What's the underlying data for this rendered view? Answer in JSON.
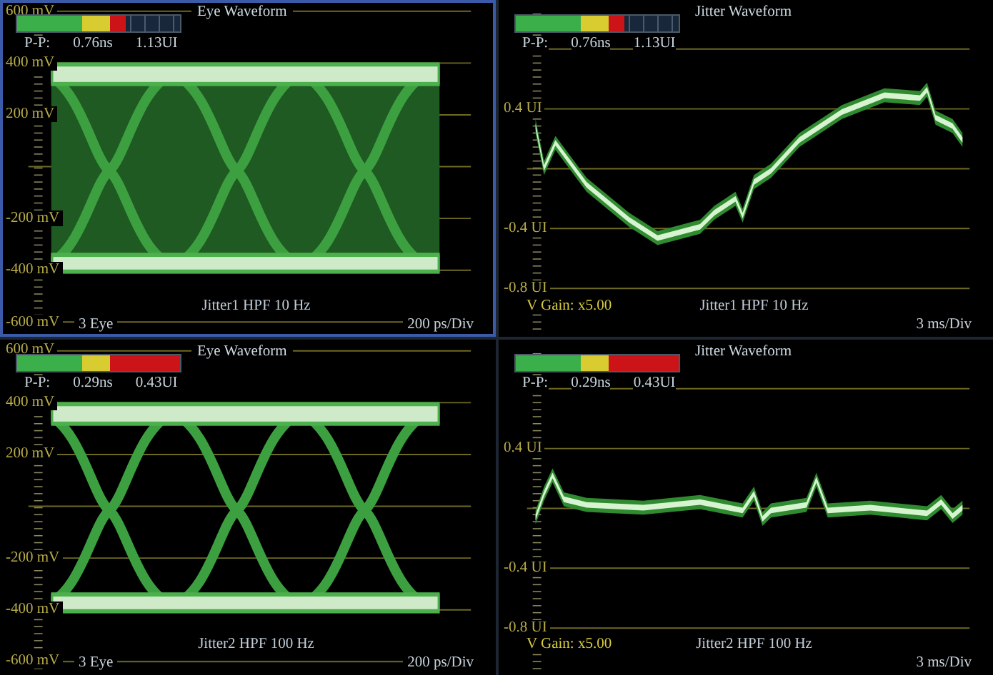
{
  "panels": [
    {
      "kind": "eye",
      "selected": true,
      "title": "Eye Waveform",
      "meter": {
        "level": 0.67
      },
      "readout": [
        "P-P:",
        "0.76ns",
        "1.13UI"
      ],
      "axis_labels": [
        "600 mV",
        "400 mV",
        "200 mV",
        "-200 mV",
        "-400 mV",
        "-600 mV"
      ],
      "caption": "Jitter1 HPF 10 Hz",
      "footer_left": "3 Eye",
      "scale": "200 ps/Div"
    },
    {
      "kind": "jitter",
      "selected": false,
      "title": "Jitter Waveform",
      "meter": {
        "level": 0.67
      },
      "readout": [
        "P-P:",
        "0.76ns",
        "1.13UI"
      ],
      "axis_labels": [
        "0.4 UI",
        "-0.4 UI",
        "-0.8 UI"
      ],
      "gain": "V Gain: x5.00",
      "caption": "Jitter1 HPF 10 Hz",
      "scale": "3 ms/Div"
    },
    {
      "kind": "eye",
      "selected": false,
      "title": "Eye Waveform",
      "meter": {
        "level": 1
      },
      "readout": [
        "P-P:",
        "0.29ns",
        "0.43UI"
      ],
      "axis_labels": [
        "600 mV",
        "400 mV",
        "200 mV",
        "-200 mV",
        "-400 mV",
        "-600 mV"
      ],
      "caption": "Jitter2 HPF 100 Hz",
      "footer_left": "3 Eye",
      "scale": "200 ps/Div"
    },
    {
      "kind": "jitter",
      "selected": false,
      "title": "Jitter Waveform",
      "meter": {
        "level": 1
      },
      "readout": [
        "P-P:",
        "0.29ns",
        "0.43UI"
      ],
      "axis_labels": [
        "0.4 UI",
        "-0.4 UI",
        "-0.8 UI"
      ],
      "gain": "V Gain: x5.00",
      "caption": "Jitter2 HPF 100 Hz",
      "scale": "3 ms/Div"
    }
  ]
}
